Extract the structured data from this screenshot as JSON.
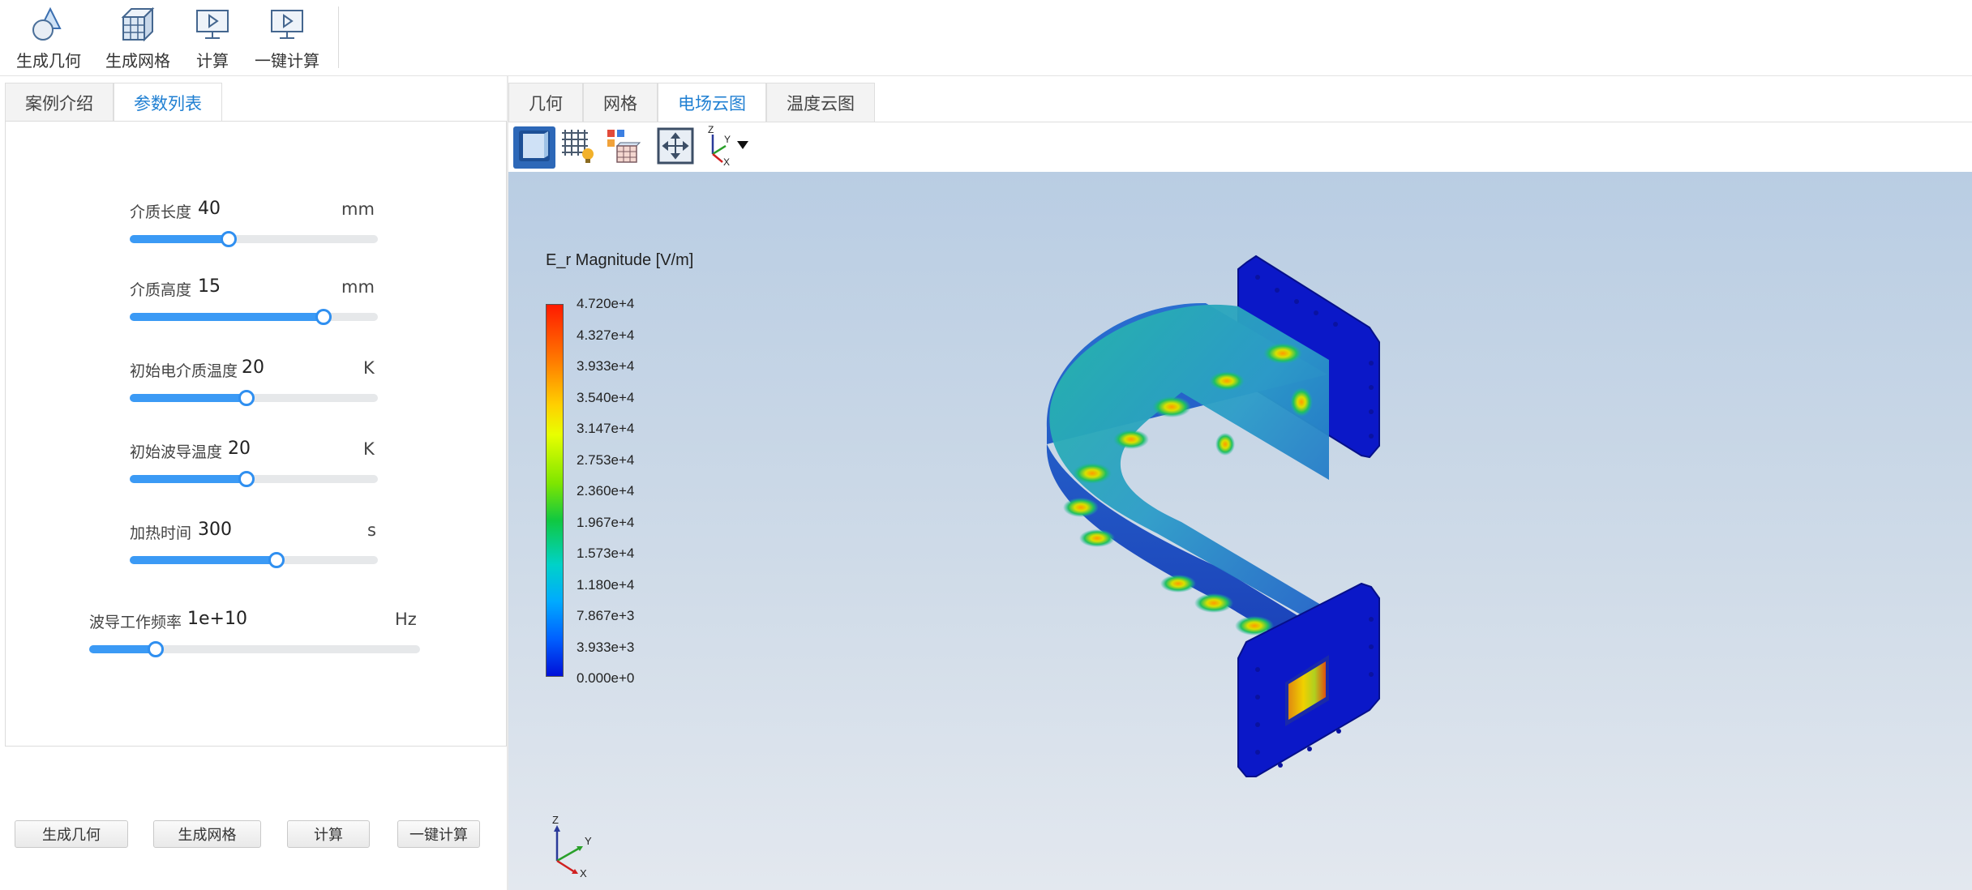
{
  "ribbon": {
    "buttons": [
      {
        "label": "生成几何",
        "icon": "geometry-icon"
      },
      {
        "label": "生成网格",
        "icon": "mesh-icon"
      },
      {
        "label": "计算",
        "icon": "compute-icon"
      },
      {
        "label": "一键计算",
        "icon": "one-click-compute-icon"
      }
    ]
  },
  "left_tabs": [
    {
      "label": "案例介绍",
      "active": false
    },
    {
      "label": "参数列表",
      "active": true
    }
  ],
  "params": [
    {
      "label": "介质长度",
      "value": "40",
      "unit": "mm",
      "fraction": 0.4
    },
    {
      "label": "介质高度",
      "value": "15",
      "unit": "mm",
      "fraction": 0.78
    },
    {
      "label": "初始电介质温度",
      "value": "20",
      "unit": "K",
      "fraction": 0.47
    },
    {
      "label": "初始波导温度",
      "value": "20",
      "unit": "K",
      "fraction": 0.47
    },
    {
      "label": "加热时间",
      "value": "300",
      "unit": "s",
      "fraction": 0.59
    },
    {
      "label": "波导工作频率",
      "value": "1e+10",
      "unit": "Hz",
      "fraction": 0.2
    }
  ],
  "bottom_buttons": [
    "生成几何",
    "生成网格",
    "计算",
    "一键计算"
  ],
  "right_tabs": [
    {
      "label": "几何",
      "active": false
    },
    {
      "label": "网格",
      "active": false
    },
    {
      "label": "电场云图",
      "active": true
    },
    {
      "label": "温度云图",
      "active": false
    }
  ],
  "view_toolbar": [
    "solid-view-icon",
    "mesh-light-icon",
    "color-grid-icon",
    "fit-view-icon",
    "axis-orient-icon"
  ],
  "legend": {
    "title": "E_r Magnitude [V/m]",
    "ticks": [
      "4.720e+4",
      "4.327e+4",
      "3.933e+4",
      "3.540e+4",
      "3.147e+4",
      "2.753e+4",
      "2.360e+4",
      "1.967e+4",
      "1.573e+4",
      "1.180e+4",
      "7.867e+3",
      "3.933e+3",
      "0.000e+0"
    ]
  },
  "triad": {
    "z": "Z",
    "y": "Y",
    "x": "X"
  },
  "colors": {
    "accent": "#1f7fd2",
    "slider": "#3b9af5",
    "flange": "#0b18c8"
  }
}
